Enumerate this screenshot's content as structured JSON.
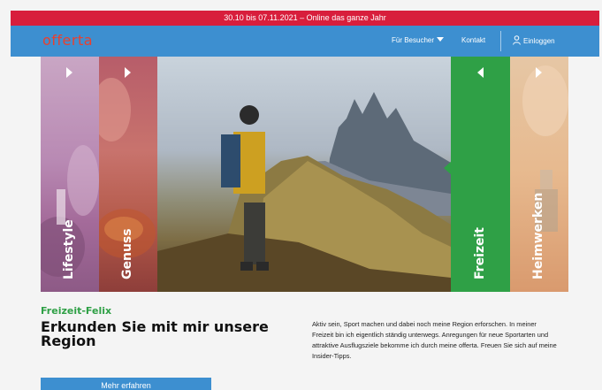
{
  "banner": {
    "text": "30.10 bis 07.11.2021 – Online das ganze Jahr"
  },
  "header": {
    "logo": "offerta",
    "nav": {
      "visitors": "Für Besucher",
      "contact": "Kontakt",
      "login": "Einloggen"
    }
  },
  "panels": {
    "lifestyle": "Lifestyle",
    "genuss": "Genuss",
    "freizeit": "Freizeit",
    "heimwerken": "Heimwerken"
  },
  "colors": {
    "brand_red": "#d81e3c",
    "nav_blue": "#3d8fd0",
    "freizeit_green": "#2fa046"
  },
  "feature": {
    "category": "Freizeit-Felix",
    "headline": "Erkunden Sie mit mir unsere Region",
    "description": "Aktiv sein, Sport machen und dabei noch meine Region erforschen. In meiner Freizeit bin ich eigentlich ständig unterwegs. Anregungen für neue Sportarten und attraktive Ausflugsziele bekomme ich durch meine offerta. Freuen Sie sich auf meine Insider-Tipps.",
    "button_label": "Mehr erfahren"
  }
}
